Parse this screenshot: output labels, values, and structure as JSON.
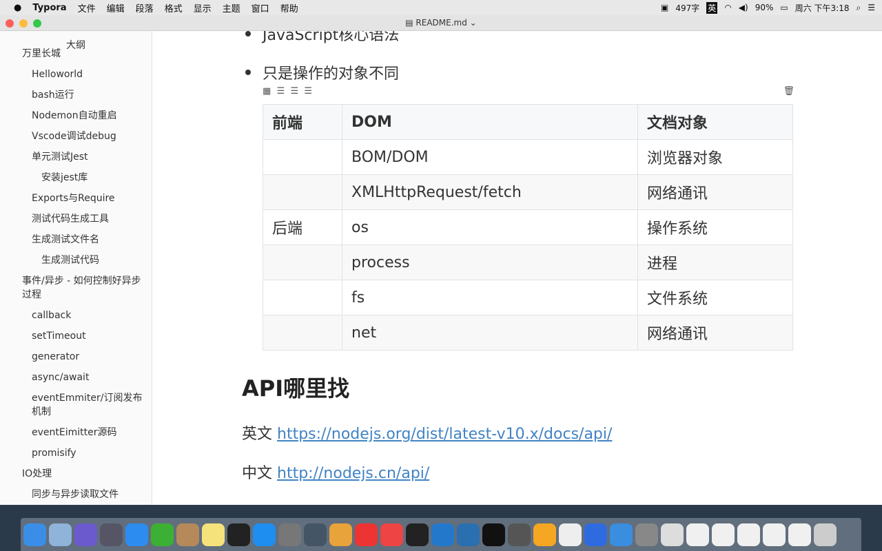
{
  "menubar": {
    "apple": "",
    "app": "Typora",
    "items": [
      "文件",
      "编辑",
      "段落",
      "格式",
      "显示",
      "主题",
      "窗口",
      "帮助"
    ],
    "status": {
      "word_count": "497字",
      "input_method": "英",
      "battery": "90%",
      "clock": "周六 下午3:18"
    }
  },
  "window": {
    "title": "README.md"
  },
  "sidebar": {
    "title": "大纲",
    "items": [
      {
        "label": "万里长城",
        "level": 1
      },
      {
        "label": "Helloworld",
        "level": 2
      },
      {
        "label": "bash运行",
        "level": 2
      },
      {
        "label": "Nodemon自动重启",
        "level": 2
      },
      {
        "label": "Vscode调试debug",
        "level": 2
      },
      {
        "label": "单元测试Jest",
        "level": 2
      },
      {
        "label": "安装jest库",
        "level": 3
      },
      {
        "label": "Exports与Require",
        "level": 2
      },
      {
        "label": "测试代码生成工具",
        "level": 2
      },
      {
        "label": "生成测试文件名",
        "level": 2
      },
      {
        "label": "生成测试代码",
        "level": 3
      },
      {
        "label": "事件/异步 - 如何控制好异步过程",
        "level": 1
      },
      {
        "label": "callback",
        "level": 2
      },
      {
        "label": "setTimeout",
        "level": 2
      },
      {
        "label": "generator",
        "level": 2
      },
      {
        "label": "async/await",
        "level": 2
      },
      {
        "label": "eventEmmiter/订阅发布机制",
        "level": 2
      },
      {
        "label": "eventEimitter源码",
        "level": 2
      },
      {
        "label": "promisify",
        "level": 2
      },
      {
        "label": "IO处理",
        "level": 1
      },
      {
        "label": "同步与异步读取文件",
        "level": 2
      }
    ]
  },
  "editor": {
    "bullets": [
      "JavaScript核心语法",
      "只是操作的对象不同"
    ],
    "table": {
      "headers": [
        "前端",
        "DOM",
        "文档对象"
      ],
      "rows": [
        [
          "",
          "BOM/DOM",
          "浏览器对象"
        ],
        [
          "",
          "XMLHttpRequest/fetch",
          "网络通讯"
        ],
        [
          "后端",
          "os",
          "操作系统"
        ],
        [
          "",
          "process",
          "进程"
        ],
        [
          "",
          "fs",
          "文件系统"
        ],
        [
          "",
          "net",
          "网络通讯"
        ]
      ]
    },
    "heading": "API哪里找",
    "links": [
      {
        "prefix": "英文",
        "url": "https://nodejs.org/dist/latest-v10.x/docs/api/"
      },
      {
        "prefix": "中文",
        "url": "http://nodejs.cn/api/"
      }
    ]
  },
  "dock": [
    "Finder",
    "Preview",
    "Siri",
    "Launchpad",
    "Safari",
    "WeChat",
    "Notefile",
    "Notes",
    "QQ",
    "App Store",
    "System Preferences",
    "Activity",
    "Chrome",
    "XMind",
    "Git",
    "Terminal",
    "VS Code",
    "QuickTime",
    "iTerm",
    "Sublime",
    "Sketch",
    "Typora",
    "WPS",
    "Keynote",
    "Screenshot",
    "Documents",
    "Window1",
    "Window2",
    "Window3",
    "Window4",
    "Window5",
    "Trash"
  ]
}
